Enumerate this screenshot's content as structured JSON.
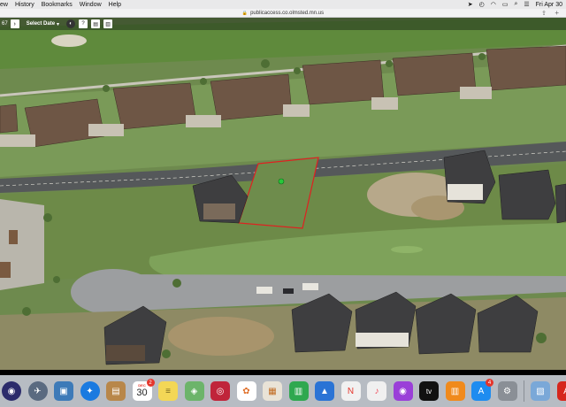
{
  "menubar": {
    "items": [
      "ew",
      "History",
      "Bookmarks",
      "Window",
      "Help"
    ],
    "date_time": "Fri Apr 30"
  },
  "browser": {
    "url": "publicaccess.co.olmsted.mn.us"
  },
  "viewer": {
    "page_number": "67",
    "select_date_label": "Select Date",
    "arrow_glyph": "›"
  },
  "map": {
    "highlight_color": "#e02020",
    "marker_color": "#28c83a"
  },
  "dock": {
    "apps": [
      {
        "name": "siri",
        "bg": "#2b2b6b",
        "glyph": "◉"
      },
      {
        "name": "launchpad",
        "bg": "#5a6a80",
        "glyph": "🚀"
      },
      {
        "name": "preview",
        "bg": "#3d7ab8",
        "glyph": "▣"
      },
      {
        "name": "safari",
        "bg": "#1a7ae0",
        "glyph": "✦"
      },
      {
        "name": "notefile",
        "bg": "#b8874a",
        "glyph": "▤"
      },
      {
        "name": "calendar",
        "bg": "#ffffff",
        "glyph": ""
      },
      {
        "name": "notes",
        "bg": "#f3d756",
        "glyph": "≡"
      },
      {
        "name": "maps",
        "bg": "#6cb46a",
        "glyph": "◈"
      },
      {
        "name": "photo-booth",
        "bg": "#c0243a",
        "glyph": "◎"
      },
      {
        "name": "photos",
        "bg": "#ffffff",
        "glyph": "✿"
      },
      {
        "name": "keynote-doc",
        "bg": "#e9e3d7",
        "glyph": "▦"
      },
      {
        "name": "numbers",
        "bg": "#2fa84f",
        "glyph": "▥"
      },
      {
        "name": "keynote",
        "bg": "#2a73d5",
        "glyph": "▲"
      },
      {
        "name": "news",
        "bg": "#f1f1f1",
        "glyph": "N"
      },
      {
        "name": "music",
        "bg": "#f0f0f0",
        "glyph": "♪"
      },
      {
        "name": "podcasts",
        "bg": "#9a3fd8",
        "glyph": "◉"
      },
      {
        "name": "tv",
        "bg": "#111111",
        "glyph": "tv"
      },
      {
        "name": "books",
        "bg": "#f08a1c",
        "glyph": "▥"
      },
      {
        "name": "app-store",
        "bg": "#1e8cf0",
        "glyph": "A"
      },
      {
        "name": "system-preferences",
        "bg": "#8a8f96",
        "glyph": "⚙"
      },
      {
        "name": "preview-2",
        "bg": "#7aa8d8",
        "glyph": "▧"
      },
      {
        "name": "acrobat",
        "bg": "#d6261c",
        "glyph": "A"
      }
    ],
    "calendar": {
      "month": "DEC",
      "day": "30",
      "badge": "2"
    },
    "app_store_badge": "4"
  }
}
